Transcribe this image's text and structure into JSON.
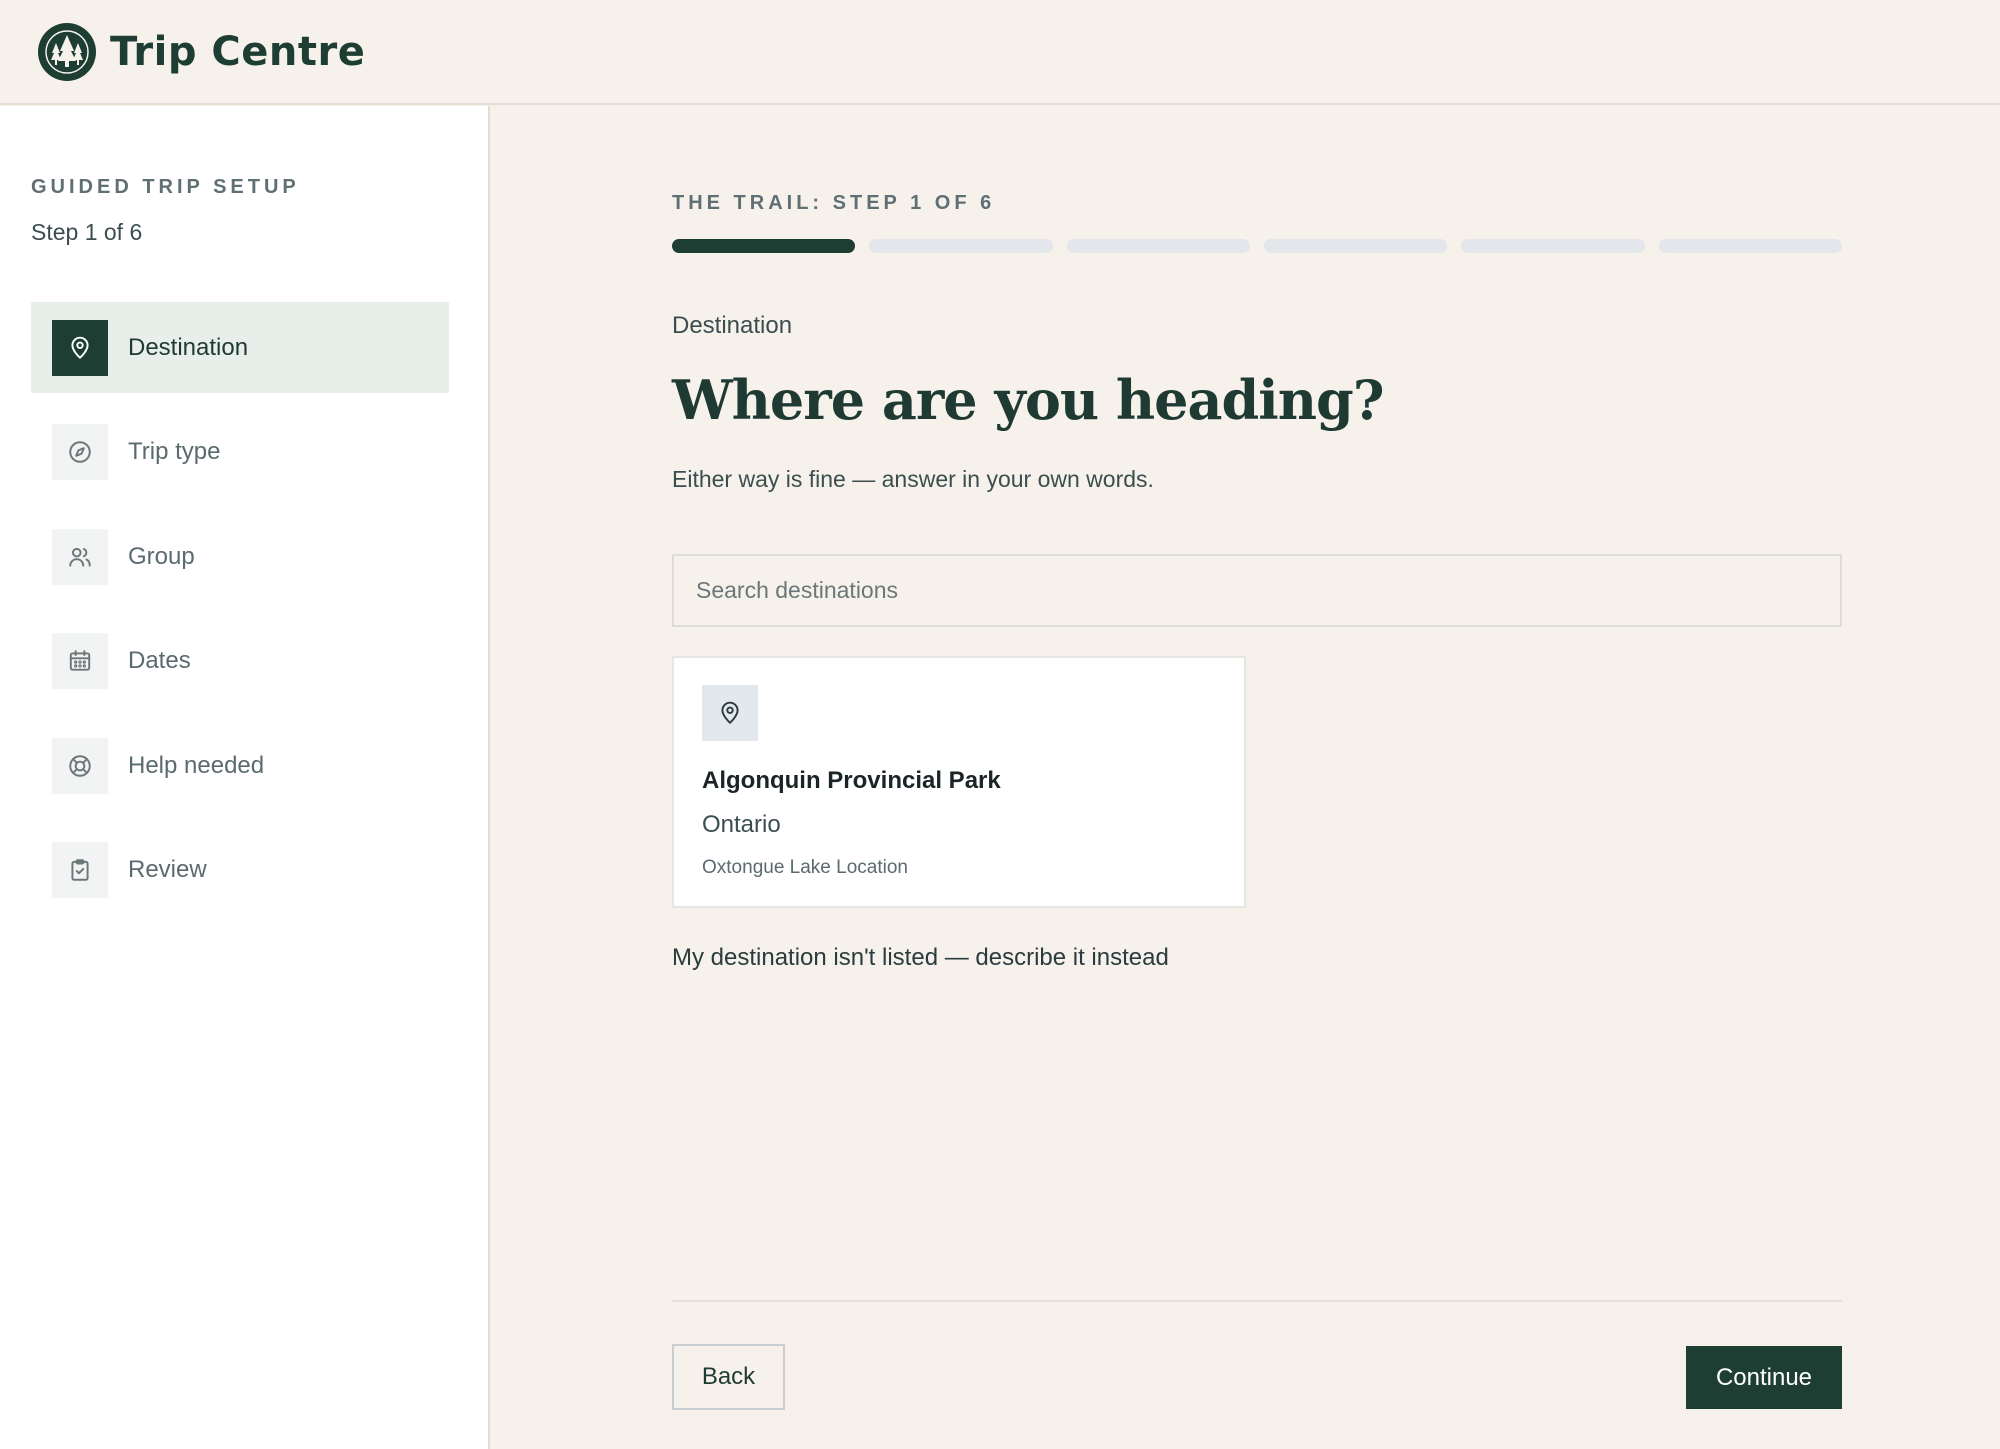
{
  "header": {
    "brand": "Trip Centre",
    "logo_icon": "pine-trees-icon"
  },
  "sidebar": {
    "kicker": "GUIDED TRIP SETUP",
    "step": "Step 1 of 6",
    "items": [
      {
        "label": "Destination",
        "icon": "map-pin-icon",
        "active": true
      },
      {
        "label": "Trip type",
        "icon": "compass-icon",
        "active": false
      },
      {
        "label": "Group",
        "icon": "users-icon",
        "active": false
      },
      {
        "label": "Dates",
        "icon": "calendar-icon",
        "active": false
      },
      {
        "label": "Help needed",
        "icon": "lifebuoy-icon",
        "active": false
      },
      {
        "label": "Review",
        "icon": "clipboard-check-icon",
        "active": false
      }
    ]
  },
  "main": {
    "trail_label": "THE TRAIL: STEP 1 OF 6",
    "progress": {
      "current": 1,
      "total": 6
    },
    "section_label": "Destination",
    "title": "Where are you heading?",
    "subtitle": "Either way is fine — answer in your own words.",
    "search": {
      "placeholder": "Search destinations",
      "value": ""
    },
    "card": {
      "icon": "map-pin-icon",
      "name": "Algonquin Provincial Park",
      "region": "Ontario",
      "location": "Oxtongue Lake Location"
    },
    "alt_link": "My destination isn't listed — describe it instead",
    "back_label": "Back",
    "continue_label": "Continue"
  },
  "colors": {
    "accent": "#1e3d33",
    "background": "#f6f2eb"
  }
}
